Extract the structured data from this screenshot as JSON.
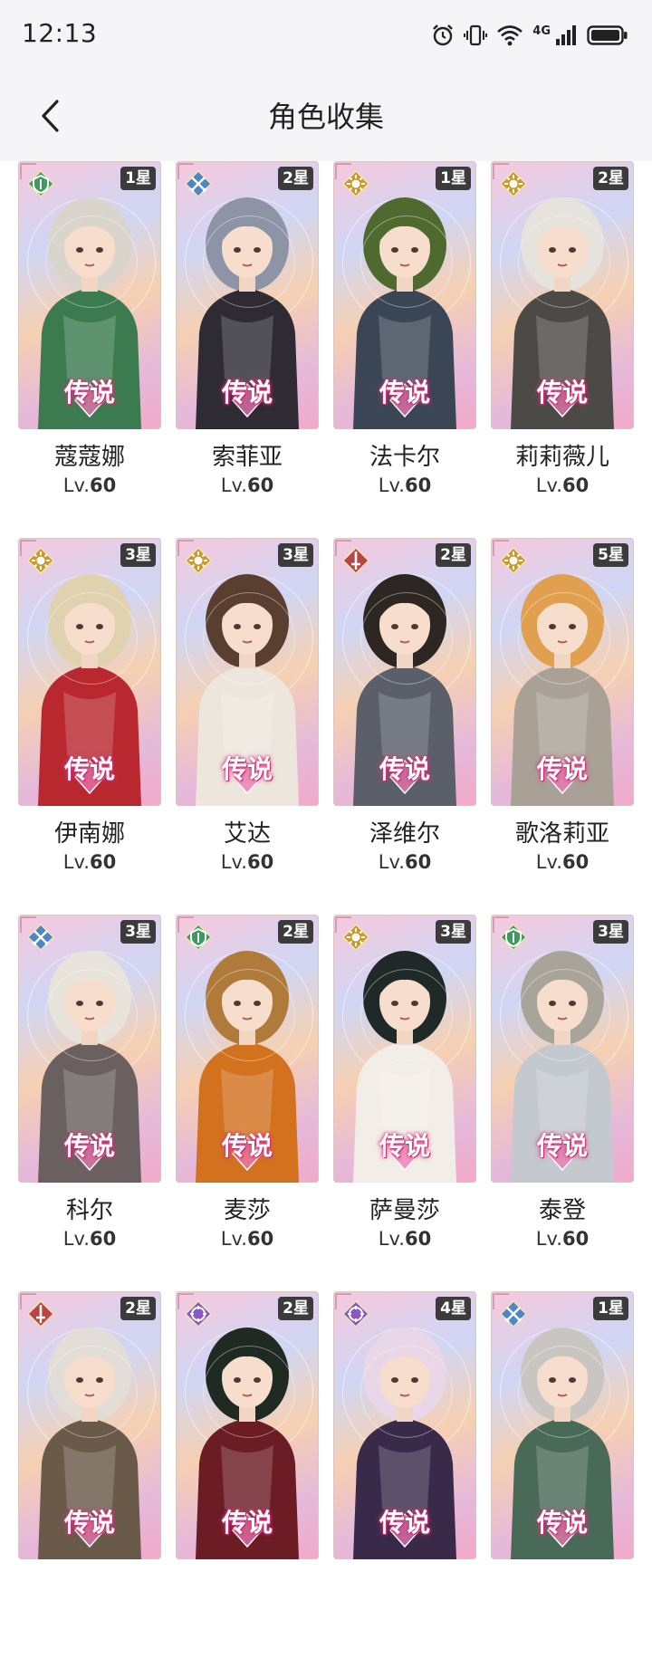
{
  "status_bar": {
    "time": "12:13",
    "network": "4G",
    "icons": [
      "alarm-icon",
      "vibrate-icon",
      "wifi-icon",
      "signal-icon",
      "battery-icon"
    ]
  },
  "header": {
    "back_icon": "chevron-left-icon",
    "title": "角色收集"
  },
  "level_prefix": "Lv.",
  "rarity_label": "传说",
  "colors": {
    "nature": "#3f9a62",
    "ice": "#4f86c6",
    "light": "#c99a2e",
    "fire": "#b84444",
    "arcane": "#8a5ac2",
    "badge_bg": "#3b3b3b"
  },
  "characters": [
    {
      "name": "蔻蔻娜",
      "level": "60",
      "stars": "1星",
      "element": "nature",
      "element_icon": "leaf-shield-icon",
      "hair": "#d9d4cc",
      "outfit": "#3c7b4f"
    },
    {
      "name": "索菲亚",
      "level": "60",
      "stars": "2星",
      "element": "ice",
      "element_icon": "crossed-swords-icon",
      "hair": "#8c94a6",
      "outfit": "#2e2b34"
    },
    {
      "name": "法卡尔",
      "level": "60",
      "stars": "1星",
      "element": "light",
      "element_icon": "sun-icon",
      "hair": "#4f6a2f",
      "outfit": "#3a4656"
    },
    {
      "name": "莉莉薇儿",
      "level": "60",
      "stars": "2星",
      "element": "light",
      "element_icon": "sun-icon",
      "hair": "#e6e2dc",
      "outfit": "#4c4a46"
    },
    {
      "name": "伊南娜",
      "level": "60",
      "stars": "3星",
      "element": "light",
      "element_icon": "sun-icon",
      "hair": "#e0d2ae",
      "outfit": "#b8282e"
    },
    {
      "name": "艾达",
      "level": "60",
      "stars": "3星",
      "element": "light",
      "element_icon": "sun-icon",
      "hair": "#5a3f30",
      "outfit": "#ede6dc"
    },
    {
      "name": "泽维尔",
      "level": "60",
      "stars": "2星",
      "element": "fire",
      "element_icon": "sword-icon",
      "hair": "#2d2622",
      "outfit": "#5a5f6a"
    },
    {
      "name": "歌洛莉亚",
      "level": "60",
      "stars": "5星",
      "element": "light",
      "element_icon": "sun-icon",
      "hair": "#e0a050",
      "outfit": "#a9a195"
    },
    {
      "name": "科尔",
      "level": "60",
      "stars": "3星",
      "element": "ice",
      "element_icon": "crossed-swords-icon",
      "hair": "#e8e4dc",
      "outfit": "#6b6060"
    },
    {
      "name": "麦莎",
      "level": "60",
      "stars": "2星",
      "element": "nature",
      "element_icon": "leaf-shield-icon",
      "hair": "#b07a3a",
      "outfit": "#d2721f"
    },
    {
      "name": "萨曼莎",
      "level": "60",
      "stars": "3星",
      "element": "light",
      "element_icon": "sun-icon",
      "hair": "#1f2a28",
      "outfit": "#f2ede6"
    },
    {
      "name": "泰登",
      "level": "60",
      "stars": "3星",
      "element": "nature",
      "element_icon": "leaf-shield-icon",
      "hair": "#a9a49a",
      "outfit": "#c4c8cf"
    },
    {
      "name": "",
      "level": "",
      "stars": "2星",
      "element": "fire",
      "element_icon": "sword-icon",
      "hair": "#e3ddd8",
      "outfit": "#6a5a4a"
    },
    {
      "name": "",
      "level": "",
      "stars": "2星",
      "element": "arcane",
      "element_icon": "arcane-icon",
      "hair": "#1f2a22",
      "outfit": "#6b1c24"
    },
    {
      "name": "",
      "level": "",
      "stars": "4星",
      "element": "arcane",
      "element_icon": "arcane-icon",
      "hair": "#e9d6e6",
      "outfit": "#3a2a4a"
    },
    {
      "name": "",
      "level": "",
      "stars": "1星",
      "element": "ice",
      "element_icon": "crossed-swords-icon",
      "hair": "#c9c6c2",
      "outfit": "#4a6a58"
    }
  ]
}
